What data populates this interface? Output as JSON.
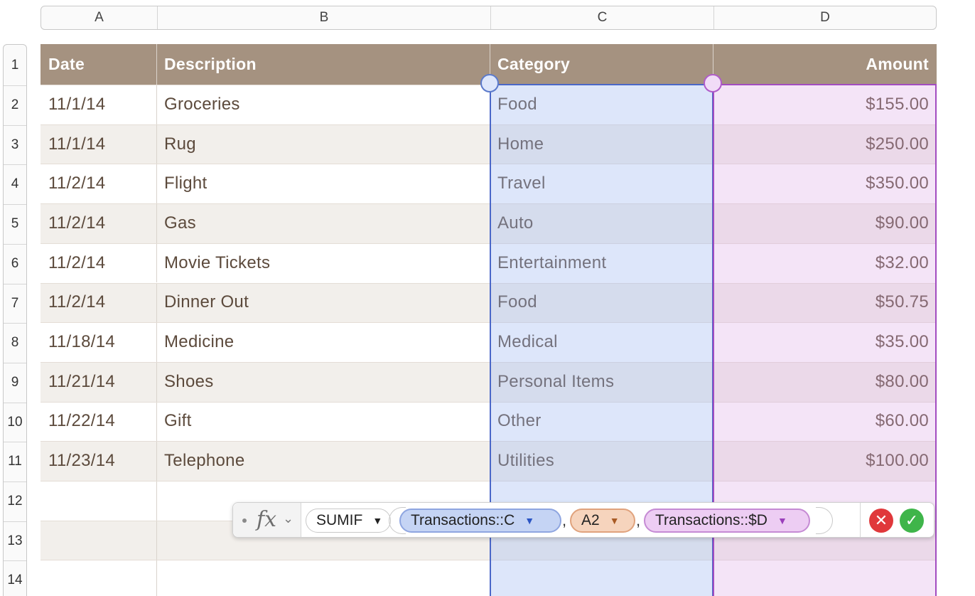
{
  "columns": [
    "A",
    "B",
    "C",
    "D"
  ],
  "rows": [
    "1",
    "2",
    "3",
    "4",
    "5",
    "6",
    "7",
    "8",
    "9",
    "10",
    "11",
    "12",
    "13",
    "14"
  ],
  "table": {
    "header": {
      "date": "Date",
      "description": "Description",
      "category": "Category",
      "amount": "Amount"
    },
    "records": [
      {
        "date": "11/1/14",
        "description": "Groceries",
        "category": "Food",
        "amount": "$155.00"
      },
      {
        "date": "11/1/14",
        "description": "Rug",
        "category": "Home",
        "amount": "$250.00"
      },
      {
        "date": "11/2/14",
        "description": "Flight",
        "category": "Travel",
        "amount": "$350.00"
      },
      {
        "date": "11/2/14",
        "description": "Gas",
        "category": "Auto",
        "amount": "$90.00"
      },
      {
        "date": "11/2/14",
        "description": "Movie Tickets",
        "category": "Entertainment",
        "amount": "$32.00"
      },
      {
        "date": "11/2/14",
        "description": "Dinner Out",
        "category": "Food",
        "amount": "$50.75"
      },
      {
        "date": "11/18/14",
        "description": "Medicine",
        "category": "Medical",
        "amount": "$35.00"
      },
      {
        "date": "11/21/14",
        "description": "Shoes",
        "category": "Personal Items",
        "amount": "$80.00"
      },
      {
        "date": "11/22/14",
        "description": "Gift",
        "category": "Other",
        "amount": "$60.00"
      },
      {
        "date": "11/23/14",
        "description": "Telephone",
        "category": "Utilities",
        "amount": "$100.00"
      }
    ]
  },
  "formula": {
    "fx_label": "fx",
    "function": "SUMIF",
    "arg1": "Transactions::C",
    "arg2": "A2",
    "arg3": "Transactions::$D",
    "separator": ","
  },
  "colors": {
    "header_bg": "#a59280",
    "ref_c": "#4a67c8",
    "ref_d": "#a24cc0",
    "cancel": "#e0383b",
    "confirm": "#3fb54a"
  },
  "icons": {
    "fx": "fx-icon",
    "chevron": "chevron-down-icon",
    "cancel": "cancel-icon",
    "confirm": "checkmark-icon"
  }
}
